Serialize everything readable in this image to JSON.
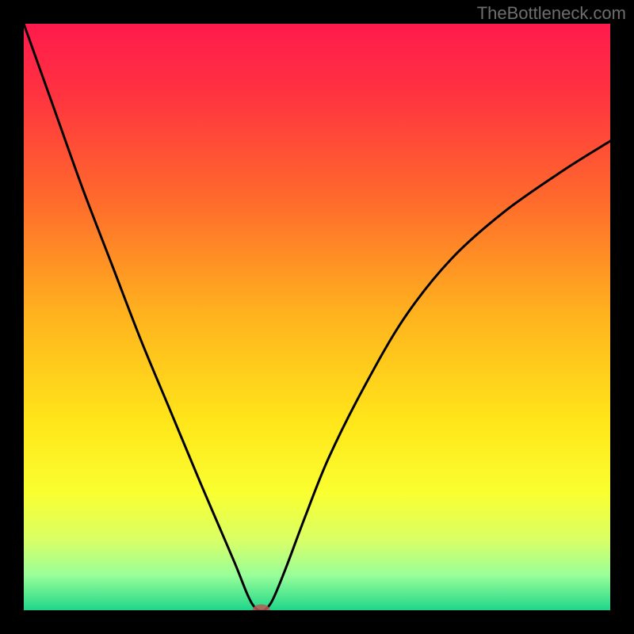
{
  "watermark": "TheBottleneck.com",
  "chart_data": {
    "type": "line",
    "title": "",
    "xlabel": "",
    "ylabel": "",
    "xlim": [
      0,
      100
    ],
    "ylim": [
      0,
      100
    ],
    "background_gradient": {
      "stops": [
        {
          "offset": 0.0,
          "color": "#ff1a4d"
        },
        {
          "offset": 0.12,
          "color": "#ff3340"
        },
        {
          "offset": 0.3,
          "color": "#ff6a2c"
        },
        {
          "offset": 0.5,
          "color": "#ffb41e"
        },
        {
          "offset": 0.68,
          "color": "#ffe61a"
        },
        {
          "offset": 0.8,
          "color": "#faff30"
        },
        {
          "offset": 0.88,
          "color": "#d9ff66"
        },
        {
          "offset": 0.94,
          "color": "#99ff99"
        },
        {
          "offset": 1.0,
          "color": "#1fd68a"
        }
      ]
    },
    "series": [
      {
        "name": "bottleneck-curve",
        "x": [
          0,
          5,
          10,
          15,
          20,
          25,
          30,
          33,
          36,
          38,
          39,
          40,
          41,
          42,
          43,
          45,
          48,
          52,
          58,
          65,
          73,
          82,
          92,
          100
        ],
        "y": [
          100,
          86,
          72,
          59,
          46,
          34,
          22,
          15,
          8,
          3,
          1,
          0,
          0,
          1,
          3,
          8,
          16,
          26,
          38,
          50,
          60,
          68,
          75,
          80
        ]
      }
    ],
    "marker": {
      "x": 40.5,
      "y": 0,
      "rx": 1.5,
      "ry": 1.0
    }
  }
}
